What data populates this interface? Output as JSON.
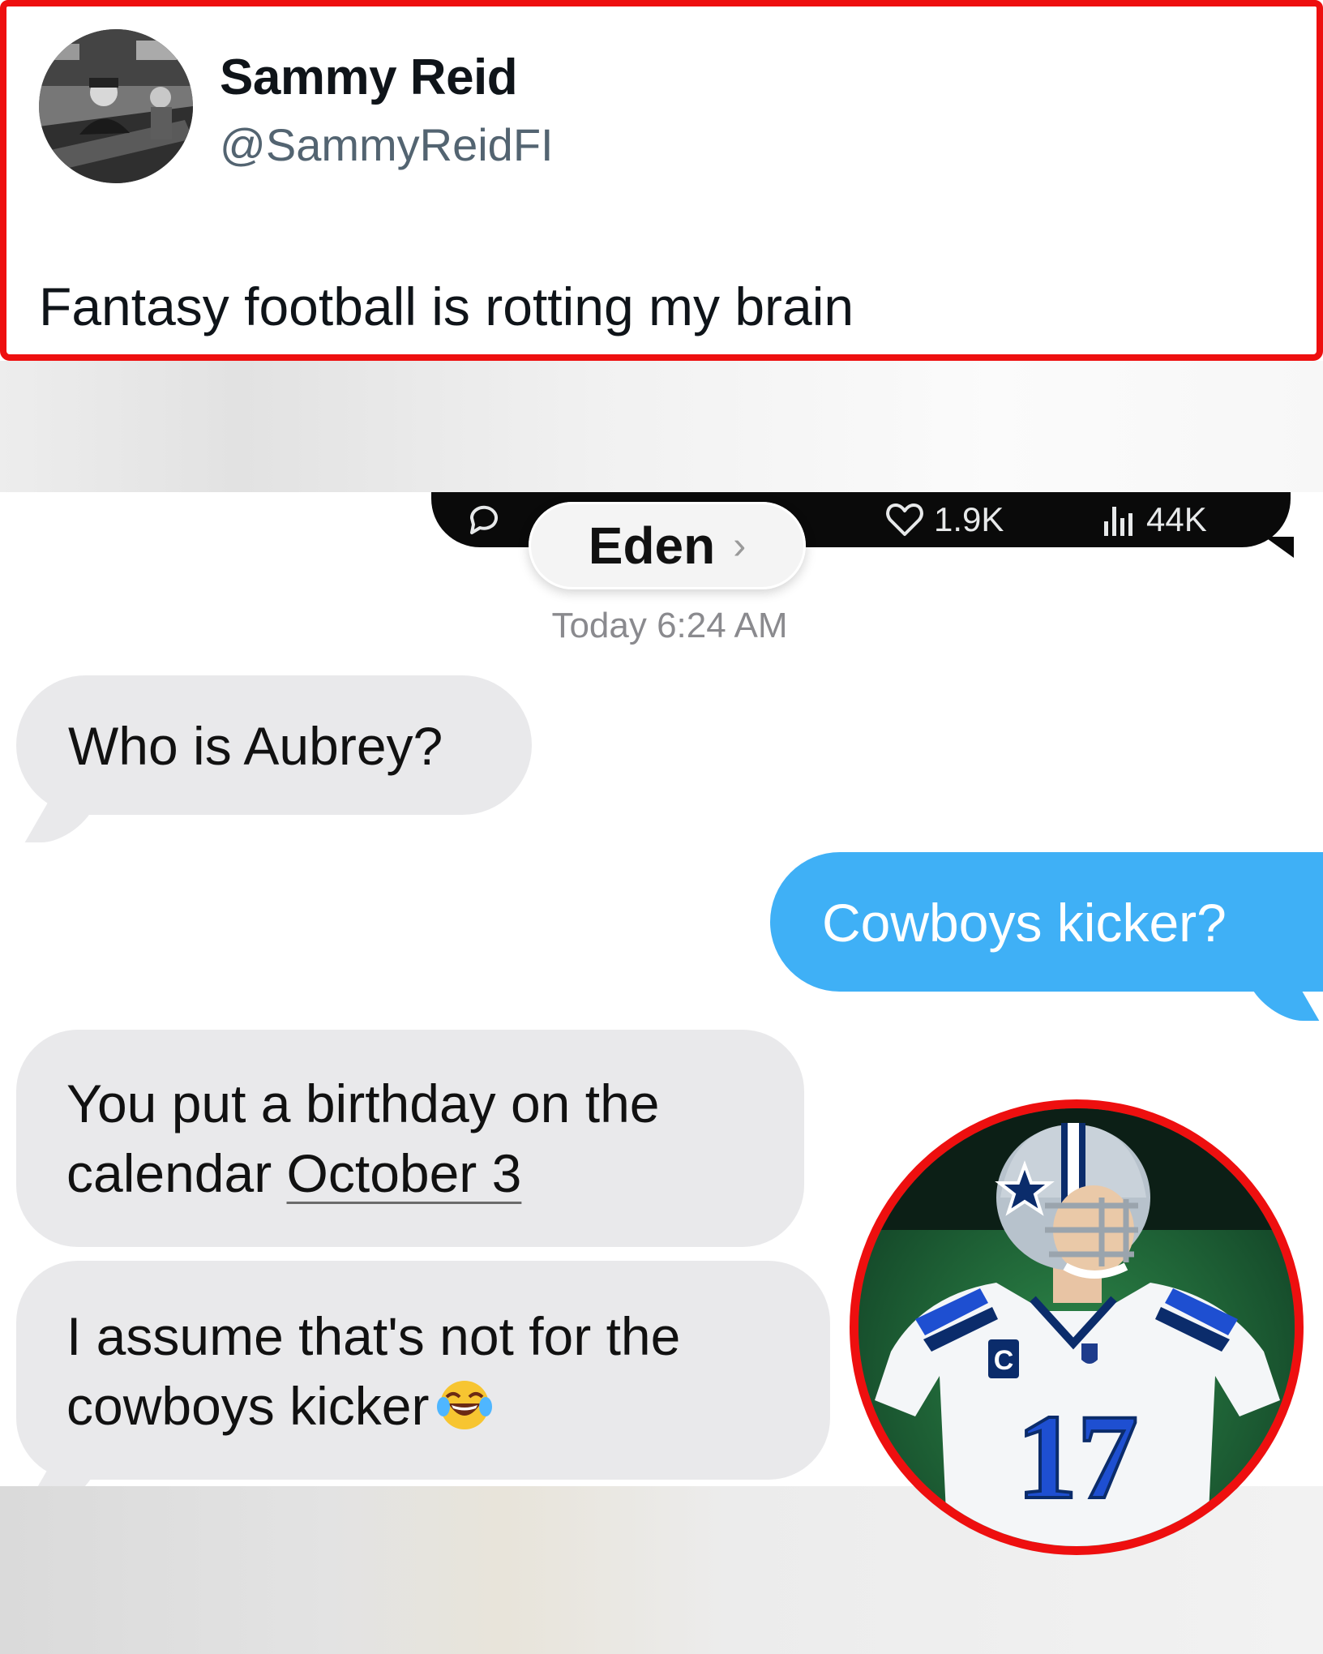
{
  "tweet": {
    "author_name": "Sammy Reid",
    "author_handle": "@SammyReidFI",
    "text": "Fantasy football is rotting my brain",
    "actions": {
      "reply_icon": "reply-icon",
      "like_icon": "heart-icon",
      "like_count": "1.9K",
      "views_icon": "views-icon",
      "view_count": "44K"
    }
  },
  "messages_thread": {
    "contact_name": "Eden",
    "contact_chevron": "›",
    "timestamp": "Today 6:24 AM",
    "messages": [
      {
        "direction": "incoming",
        "text": "Who is Aubrey?"
      },
      {
        "direction": "outgoing",
        "text": "Cowboys kicker?"
      },
      {
        "direction": "incoming",
        "text_line1": "You put a birthday on the",
        "text_line2_prefix": "calendar ",
        "date_link": "October 3"
      },
      {
        "direction": "incoming",
        "text_line1": "I assume that's not for the",
        "text_line2": "cowboys kicker",
        "emoji": "face-with-tears-of-joy"
      }
    ]
  },
  "player_photo": {
    "jersey_number": "17",
    "captain_patch": "C"
  },
  "colors": {
    "highlight_red": "#ee0f0f",
    "imessage_blue": "#3fb0f6",
    "incoming_gray": "#e9e9eb",
    "cowboys_navy": "#0b2c6b",
    "cowboys_blue": "#1e4fd1"
  }
}
